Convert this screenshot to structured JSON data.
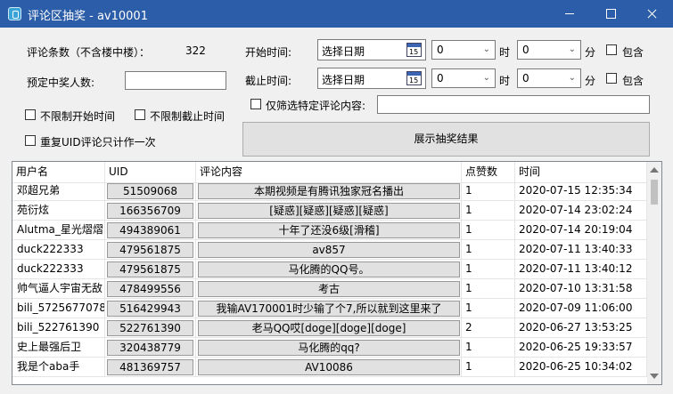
{
  "window": {
    "title": "评论区抽奖 - av10001"
  },
  "form": {
    "comment_count_label": "评论条数（不含楼中楼）：",
    "comment_count_value": "322",
    "winners_label": "预定中奖人数:",
    "winners_value": "",
    "start_time_label": "开始时间:",
    "end_time_label": "截止时间:",
    "date_placeholder": "选择日期",
    "hour_value": "0",
    "minute_value": "0",
    "hour_unit": "时",
    "minute_unit": "分",
    "include_label": "包含",
    "no_start_label": "不限制开始时间",
    "no_end_label": "不限制截止时间",
    "duplicate_uid_label": "重复UID评论只计作一次",
    "filter_comment_label": "仅筛选特定评论内容:",
    "filter_comment_value": "",
    "show_result_button": "展示抽奖结果"
  },
  "table": {
    "headers": [
      "用户名",
      "UID",
      "评论内容",
      "点赞数",
      "时间"
    ],
    "rows": [
      {
        "name": "邓超兄弟",
        "uid": "51509068",
        "comment": "本期视频是有腾讯独家冠名播出",
        "likes": "1",
        "time": "2020-07-15 12:35:34"
      },
      {
        "name": "苑衍炫",
        "uid": "166356709",
        "comment": "[疑惑][疑惑][疑惑][疑惑]",
        "likes": "1",
        "time": "2020-07-14 23:02:24"
      },
      {
        "name": "Alutma_星光熠熠",
        "uid": "494389061",
        "comment": "十年了还没6级[滑稽]",
        "likes": "1",
        "time": "2020-07-14 20:19:04"
      },
      {
        "name": "duck222333",
        "uid": "479561875",
        "comment": "av857",
        "likes": "1",
        "time": "2020-07-11 13:40:33"
      },
      {
        "name": "duck222333",
        "uid": "479561875",
        "comment": "马化腾的QQ号。",
        "likes": "1",
        "time": "2020-07-11 13:40:12"
      },
      {
        "name": "帅气逼人宇宙无敌",
        "uid": "478499556",
        "comment": "考古",
        "likes": "1",
        "time": "2020-07-10 13:31:58"
      },
      {
        "name": "bili_5725677078",
        "uid": "516429943",
        "comment": "我输AV170001时少输了个7,所以就到这里来了",
        "likes": "1",
        "time": "2020-07-09 11:06:00"
      },
      {
        "name": "bili_522761390",
        "uid": "522761390",
        "comment": "老马QQ哎[doge][doge][doge]",
        "likes": "2",
        "time": "2020-06-27 13:53:25"
      },
      {
        "name": "史上最强后卫",
        "uid": "320438779",
        "comment": "马化腾的qq?",
        "likes": "1",
        "time": "2020-06-25 19:33:57"
      },
      {
        "name": "我是个aba手",
        "uid": "481369757",
        "comment": "AV10086",
        "likes": "1",
        "time": "2020-06-25 10:34:02"
      }
    ]
  }
}
